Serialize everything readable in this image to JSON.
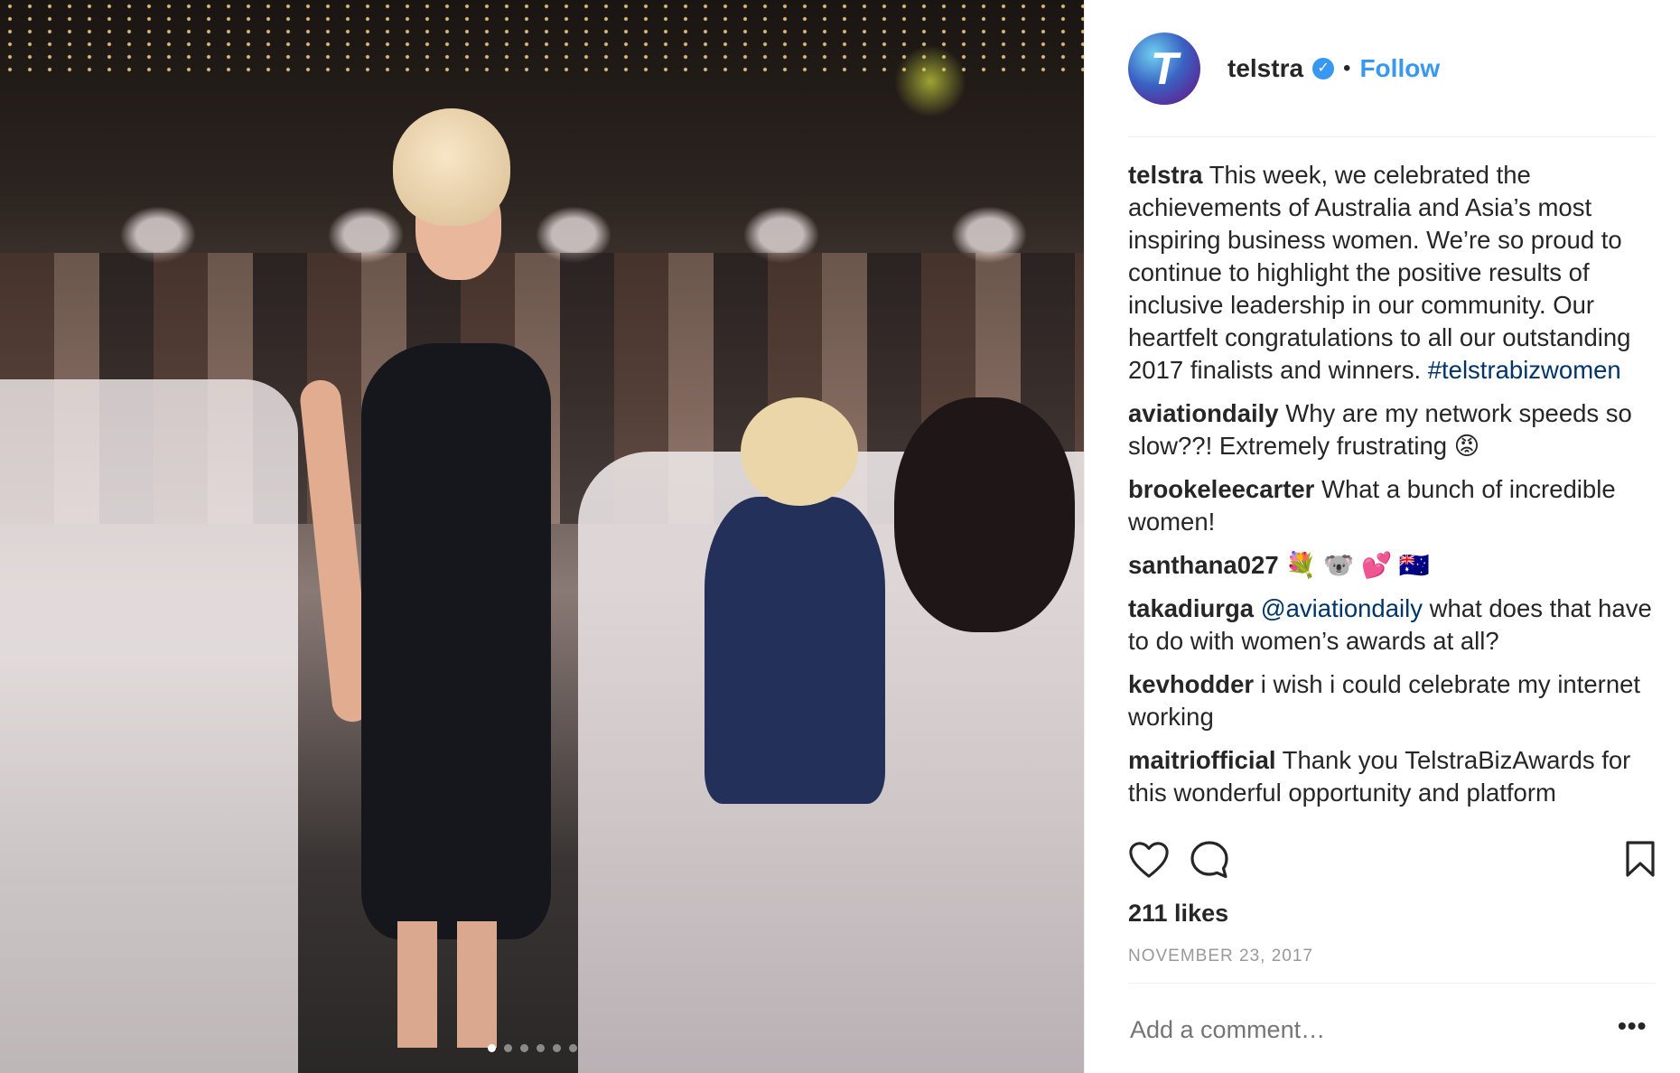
{
  "post": {
    "username": "telstra",
    "follow_label": "Follow",
    "separator": "•",
    "avatar_glyph": "T",
    "verified_glyph": "✓",
    "brand_color": "#3897f0",
    "likes": "211 likes",
    "date": "NOVEMBER 23, 2017",
    "add_comment_placeholder": "Add a comment…",
    "more_label": "•••",
    "carousel": {
      "slide_count": 6,
      "active_index": 0
    }
  },
  "caption": {
    "user": "telstra",
    "text": " This week, we celebrated the achievements of Australia and Asia’s most inspiring business women. We’re so proud to continue to highlight the positive results of inclusive leadership in our community. Our heartfelt congratulations to all our outstanding 2017 finalists and winners. ",
    "hashtag": "#telstrabizwomen"
  },
  "comments": [
    {
      "user": "aviationdaily",
      "text": " Why are my network speeds so slow??! Extremely frustrating 😡"
    },
    {
      "user": "brookeleecarter",
      "text": " What a bunch of incredible women!"
    },
    {
      "user": "santhana027",
      "text": " 💐 🐨 💕 🇦🇺"
    },
    {
      "user": "takadiurga",
      "mention": " @aviationdaily",
      "text": " what does that have to do with women’s awards at all?"
    },
    {
      "user": "kevhodder",
      "text": " i wish i could celebrate my internet working"
    },
    {
      "user": "maitriofficial",
      "text": " Thank you TelstraBizAwards for this wonderful opportunity and platform"
    }
  ],
  "icons": {
    "like": "heart-icon",
    "comment": "comment-bubble-icon",
    "save": "bookmark-icon",
    "verified": "verified-badge-icon"
  }
}
